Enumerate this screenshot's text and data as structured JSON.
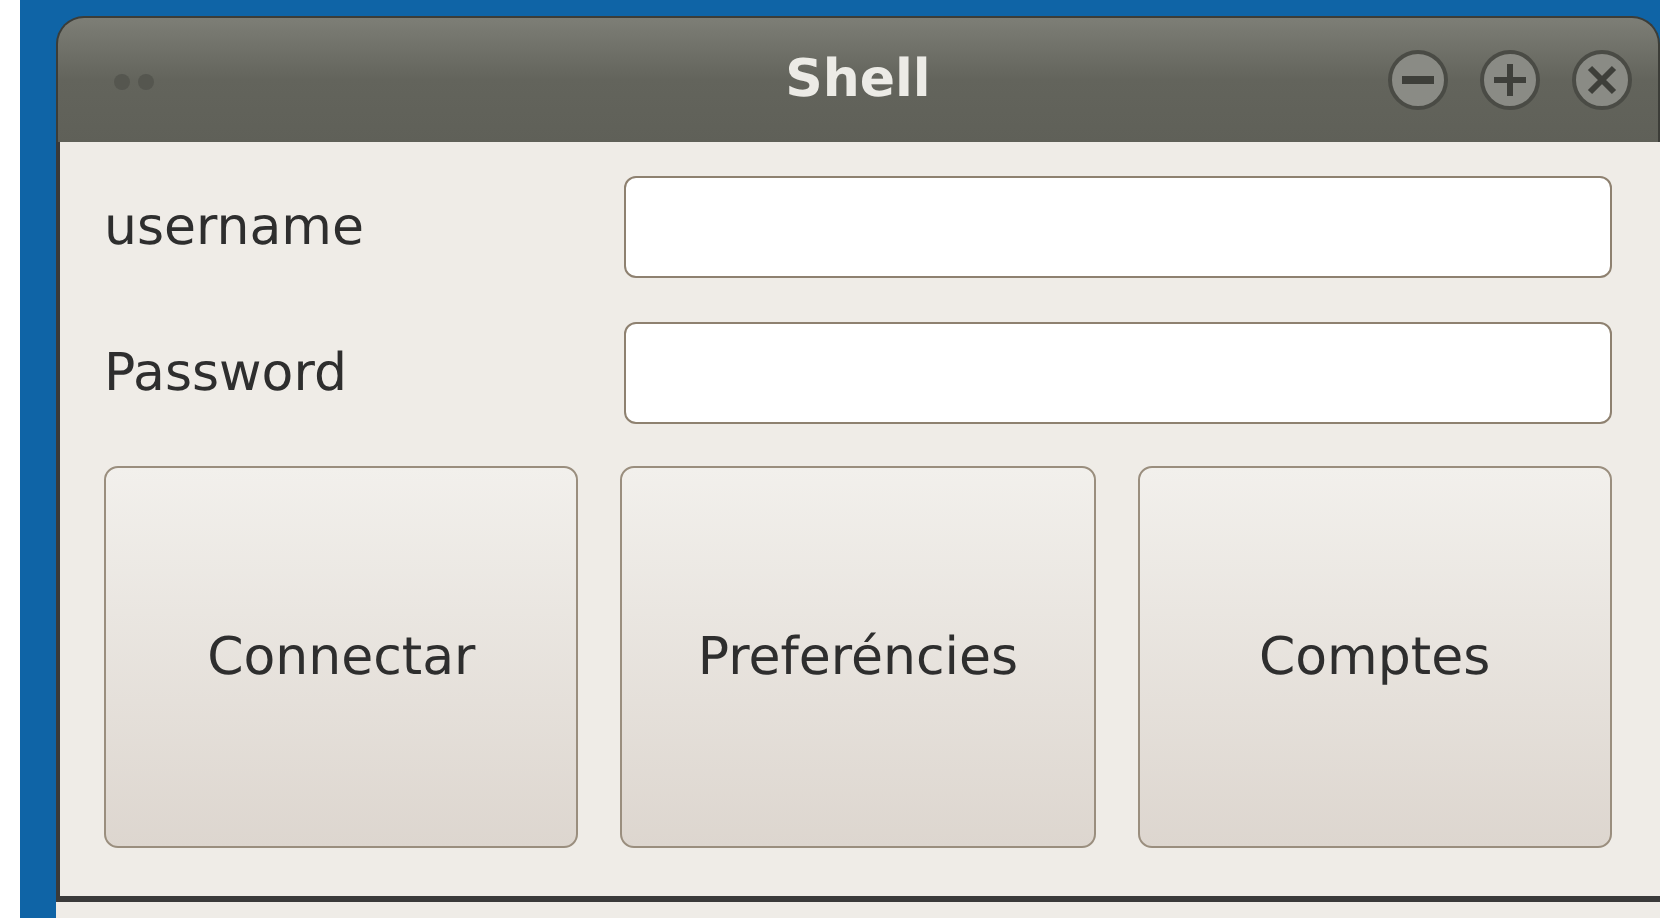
{
  "window": {
    "title": "Shell"
  },
  "fields": [
    {
      "label": "username"
    },
    {
      "label": "Password"
    }
  ],
  "buttons": [
    "Connectar",
    "Preferéncies",
    "Comptes"
  ]
}
